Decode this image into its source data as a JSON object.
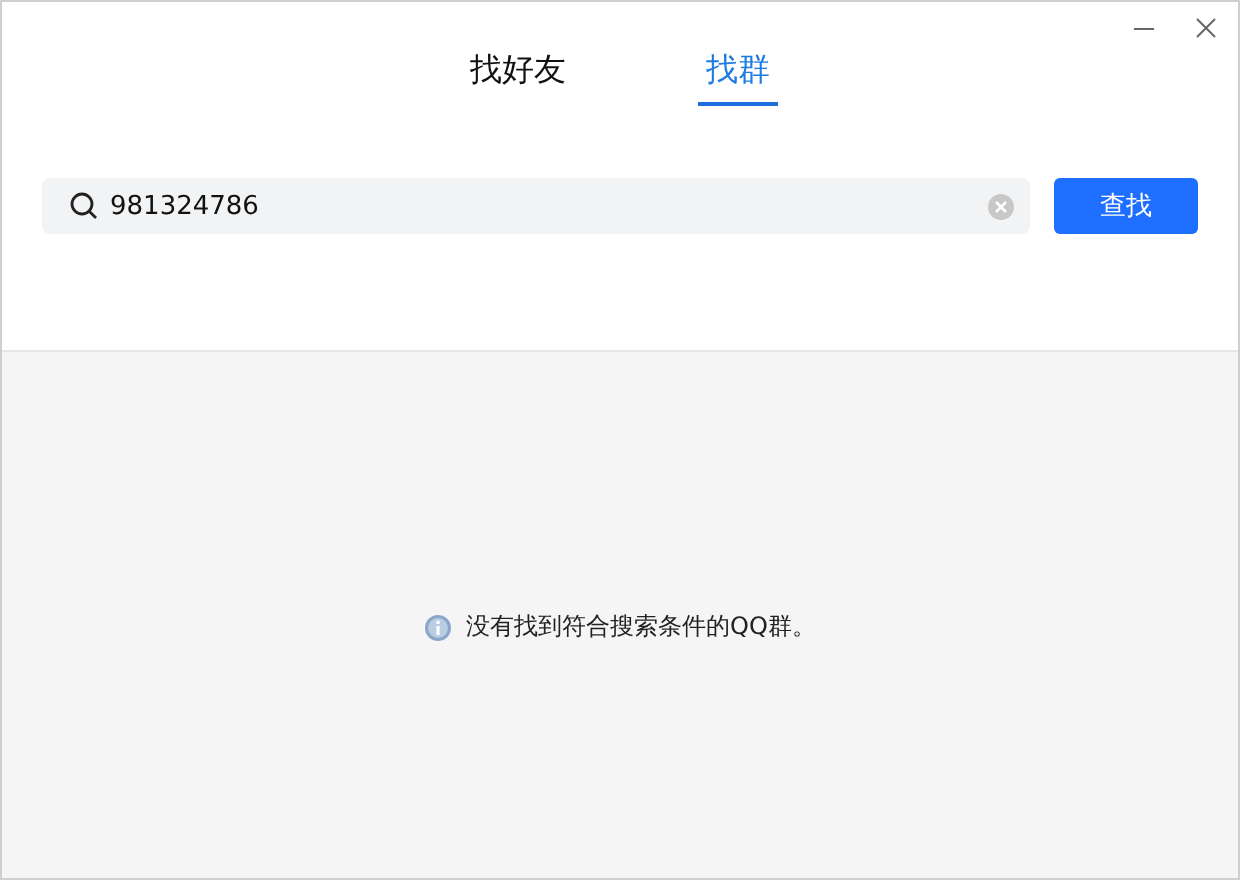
{
  "tabs": [
    {
      "label": "找好友",
      "selected": false
    },
    {
      "label": "找群",
      "selected": true
    }
  ],
  "search": {
    "value": "981324786"
  },
  "search_button": "查找",
  "message": "没有找到符合搜索条件的QQ群。"
}
